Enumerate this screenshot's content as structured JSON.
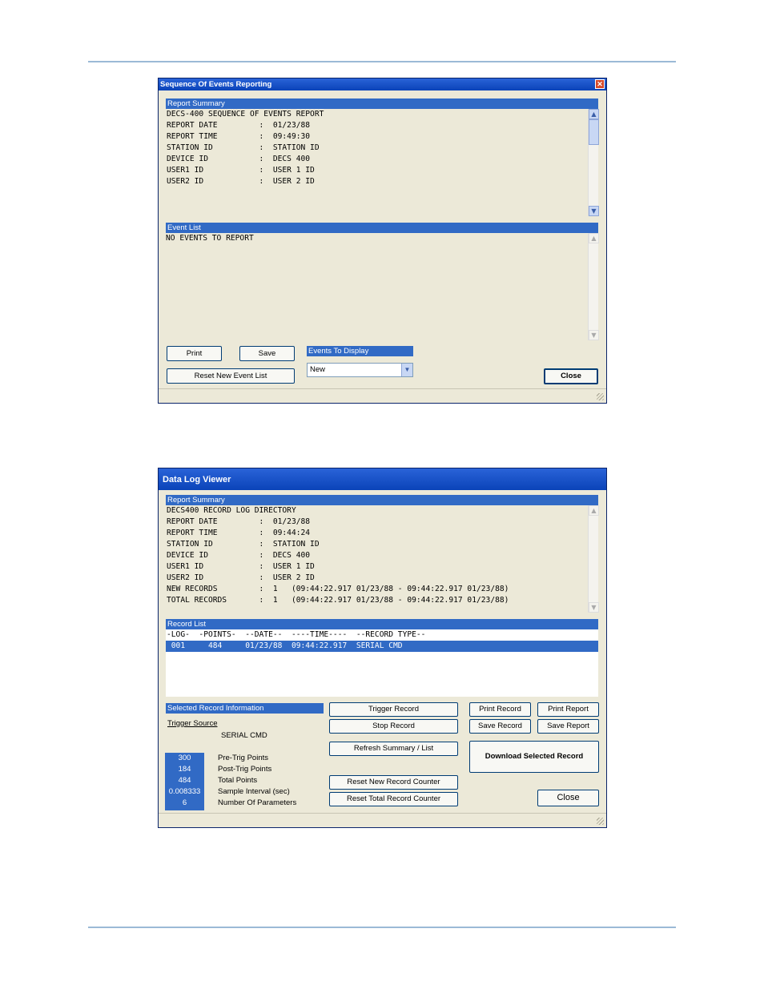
{
  "soe": {
    "title": "Sequence Of Events Reporting",
    "summary_header": "Report Summary",
    "summary_lines": [
      "DECS-400 SEQUENCE OF EVENTS REPORT",
      "REPORT DATE         :  01/23/88",
      "REPORT TIME         :  09:49:30",
      "STATION ID          :  STATION ID",
      "DEVICE ID           :  DECS 400",
      "USER1 ID            :  USER 1 ID",
      "USER2 ID            :  USER 2 ID"
    ],
    "event_list_header": "Event List",
    "event_list_text": "NO EVENTS TO REPORT",
    "print_label": "Print",
    "save_label": "Save",
    "reset_label": "Reset New Event List",
    "events_to_display_header": "Events To Display",
    "events_to_display_value": "New",
    "close_label": "Close"
  },
  "dlv": {
    "title": "Data Log Viewer",
    "summary_header": "Report Summary",
    "summary_lines": [
      "DECS400 RECORD LOG DIRECTORY",
      "REPORT DATE         :  01/23/88",
      "REPORT TIME         :  09:44:24",
      "STATION ID          :  STATION ID",
      "DEVICE ID           :  DECS 400",
      "USER1 ID            :  USER 1 ID",
      "USER2 ID            :  USER 2 ID",
      "NEW RECORDS         :  1   (09:44:22.917 01/23/88 - 09:44:22.917 01/23/88)",
      "TOTAL RECORDS       :  1   (09:44:22.917 01/23/88 - 09:44:22.917 01/23/88)"
    ],
    "record_list_header": "Record List",
    "record_columns": "-LOG-  -POINTS-  --DATE--  ----TIME----  --RECORD TYPE--",
    "record_row": " 001     484     01/23/88  09:44:22.917  SERIAL CMD",
    "selected_info_header": "Selected Record Information",
    "trigger_source_label": "Trigger Source",
    "trigger_source_value": "SERIAL CMD",
    "values": [
      {
        "value": "300",
        "label": "Pre-Trig Points"
      },
      {
        "value": "184",
        "label": "Post-Trig Points"
      },
      {
        "value": "484",
        "label": "Total Points"
      },
      {
        "value": "0.008333",
        "label": "Sample Interval (sec)"
      },
      {
        "value": "6",
        "label": "Number Of Parameters"
      }
    ],
    "trigger_record_label": "Trigger Record",
    "stop_record_label": "Stop Record",
    "refresh_label": "Refresh Summary / List",
    "reset_new_label": "Reset New Record Counter",
    "reset_total_label": "Reset Total Record Counter",
    "print_record_label": "Print Record",
    "print_report_label": "Print Report",
    "save_record_label": "Save Record",
    "save_report_label": "Save Report",
    "download_label": "Download Selected Record",
    "close_label": "Close"
  }
}
